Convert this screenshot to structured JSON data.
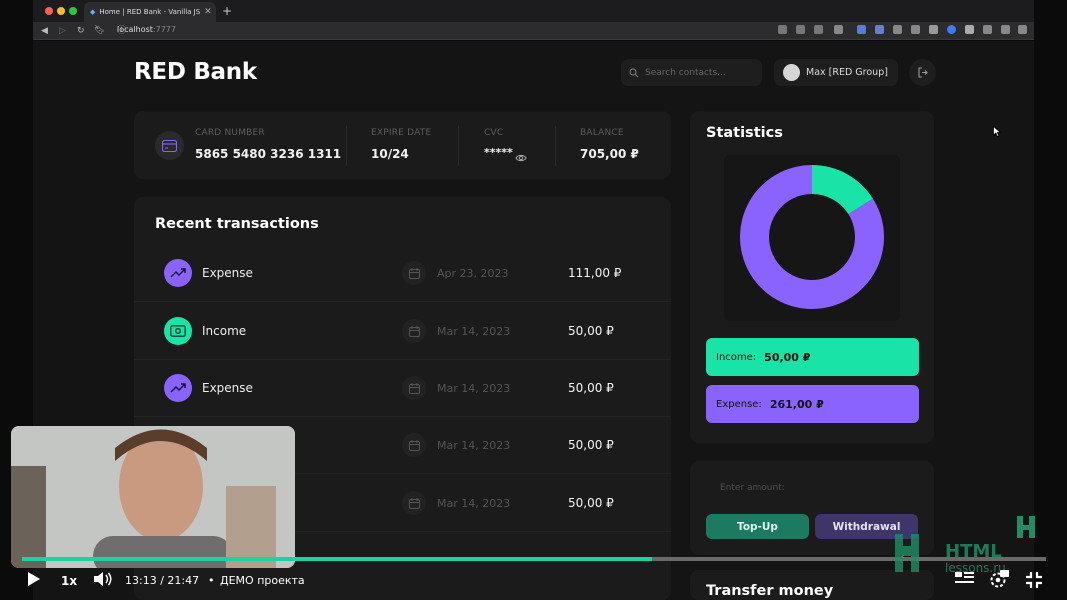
{
  "browser": {
    "tab_title": "Home | RED Bank - Vanilla JS",
    "url_host": "localhost",
    "url_port": ":7777"
  },
  "app": {
    "logo": "RED Bank",
    "search_placeholder": "Search contacts...",
    "user_name": "Max [RED Group]"
  },
  "card_info": {
    "card_number_label": "CARD NUMBER",
    "card_number": "5865 5480 3236 1311",
    "expire_label": "EXPIRE DATE",
    "expire": "10/24",
    "cvc_label": "CVC",
    "cvc": "*****",
    "balance_label": "BALANCE",
    "balance": "705,00 ₽"
  },
  "transactions": {
    "title": "Recent transactions",
    "rows": [
      {
        "type": "Expense",
        "date": "Apr 23, 2023",
        "amount": "111,00 ₽",
        "icon": "trend-up-icon"
      },
      {
        "type": "Income",
        "date": "Mar 14, 2023",
        "amount": "50,00 ₽",
        "icon": "cash-icon"
      },
      {
        "type": "Expense",
        "date": "Mar 14, 2023",
        "amount": "50,00 ₽",
        "icon": "trend-up-icon"
      },
      {
        "type": "",
        "date": "Mar 14, 2023",
        "amount": "50,00 ₽",
        "icon": ""
      },
      {
        "type": "",
        "date": "Mar 14, 2023",
        "amount": "50,00 ₽",
        "icon": ""
      }
    ]
  },
  "statistics": {
    "title": "Statistics",
    "income_label": "Income:",
    "income_value": "50,00 ₽",
    "expense_label": "Expense:",
    "expense_value": "261,00 ₽"
  },
  "chart_data": {
    "type": "pie",
    "categories": [
      "Income",
      "Expense"
    ],
    "values": [
      50,
      261
    ],
    "colors": [
      "#19e3a7",
      "#8a63ff"
    ],
    "donut": true
  },
  "actions": {
    "amount_placeholder": "Enter amount:",
    "topup_label": "Top-Up",
    "withdraw_label": "Withdrawal"
  },
  "transfer": {
    "title": "Transfer money"
  },
  "player": {
    "speed": "1x",
    "time": "13:13 / 21:47",
    "bullet": "•",
    "chapter": "ДЕМО проекта",
    "watermark_line1": "HTML",
    "watermark_line2": "lessons.ru"
  },
  "colors": {
    "accent_income": "#19e3a7",
    "accent_expense": "#8a63ff",
    "progress": "#19d4a0"
  }
}
